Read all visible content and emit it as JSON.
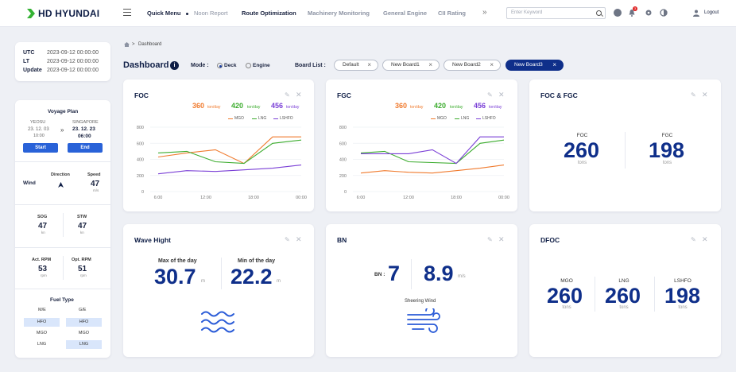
{
  "app": {
    "logo": "HD HYUNDAI",
    "nav": [
      "Quick Menu",
      "Noon Report",
      "Route Optimization",
      "Machinery Monitoring",
      "General Engine",
      "CII Rating"
    ],
    "search_placeholder": "Enter Keyword",
    "notification_count": "3",
    "logout": "Logout",
    "accent": "#2962d8",
    "brand_green": "#34b233"
  },
  "time": [
    {
      "label": "UTC",
      "value": "2023-09-12 00:00:00"
    },
    {
      "label": "LT",
      "value": "2023-09-12 00:00:00"
    },
    {
      "label": "Update",
      "value": "2023-09-12 00:00:00"
    }
  ],
  "voyage": {
    "title": "Voyage Plan",
    "from_port": "YEOSU",
    "to_port": "SINGAPORE",
    "from_date": "23. 12. 03",
    "from_time": "10:00",
    "to_date": "23. 12. 23",
    "to_time": "06:00",
    "start_label": "Start",
    "end_label": "End"
  },
  "wind": {
    "label": "Wind",
    "direction_label": "Direction",
    "speed_label": "Speed",
    "speed_value": "47",
    "speed_unit": "m/s"
  },
  "sog_stw": {
    "sog_label": "SOG",
    "sog_value": "47",
    "sog_unit": "kn",
    "stw_label": "STW",
    "stw_value": "47",
    "stw_unit": "kn"
  },
  "rpm": {
    "act_label": "Act. RPM",
    "act_value": "53",
    "act_unit": "rpm",
    "opt_label": "Opt. RPM",
    "opt_value": "51",
    "opt_unit": "rpm"
  },
  "fuel": {
    "title": "Fuel Type",
    "col1": "M/E",
    "col2": "G/E",
    "rows": [
      [
        "HFO",
        "HFO"
      ],
      [
        "MGO",
        "MGO"
      ],
      [
        "LNG",
        "LNG"
      ]
    ]
  },
  "breadcrumb": "Dashboard",
  "dashboard": {
    "title": "Dashboard",
    "info": "i",
    "mode_label": "Mode :",
    "mode_deck": "Deck",
    "mode_engine": "Engine",
    "board_label": "Board List :",
    "boards": [
      "Default",
      "New Board1",
      "New Board2",
      "New Board3"
    ],
    "active_board": "New Board3"
  },
  "cards": {
    "foc": {
      "title": "FOC",
      "v1": "360",
      "v2": "420",
      "v3": "456",
      "unit": "ton/day",
      "s1": "MGO",
      "s2": "LNG",
      "s3": "LSHFO"
    },
    "fgc": {
      "title": "FGC",
      "v1": "360",
      "v2": "420",
      "v3": "456",
      "unit": "ton/day",
      "s1": "MGO",
      "s2": "LNG",
      "s3": "LSHFO"
    },
    "foc_fgc": {
      "title": "FOC & FGC",
      "foc_label": "FOC",
      "foc_value": "260",
      "fgc_label": "FGC",
      "fgc_value": "198",
      "unit": "tons"
    },
    "wave": {
      "title": "Wave Hight",
      "max_label": "Max of the day",
      "max_value": "30.7",
      "min_label": "Min of the day",
      "min_value": "22.2",
      "unit": "m"
    },
    "bn": {
      "title": "BN",
      "bn_label": "BN :",
      "bn_value": "7",
      "speed_value": "8.9",
      "speed_unit": "m/s",
      "caption": "Sheering Wind"
    },
    "dfoc": {
      "title": "DFOC",
      "l1": "MGO",
      "v1": "260",
      "l2": "LNG",
      "v2": "260",
      "l3": "LSHFO",
      "v3": "198",
      "unit": "tons"
    }
  },
  "chart_data": [
    {
      "type": "line",
      "title": "FOC",
      "x": [
        "6:00",
        "12:00",
        "18:00",
        "00:00"
      ],
      "ylim": [
        0,
        800
      ],
      "yticks": [
        "800",
        "600",
        "400",
        "200",
        "0"
      ],
      "series": [
        {
          "name": "MGO",
          "color": "#f07a2d",
          "values": [
            430,
            480,
            520,
            350,
            680,
            680
          ]
        },
        {
          "name": "LNG",
          "color": "#3cac2e",
          "values": [
            480,
            500,
            370,
            350,
            600,
            640
          ]
        },
        {
          "name": "LSHFO",
          "color": "#7a3fd6",
          "values": [
            220,
            260,
            250,
            270,
            290,
            330
          ]
        }
      ]
    },
    {
      "type": "line",
      "title": "FGC",
      "x": [
        "6:00",
        "12:00",
        "18:00",
        "00:00"
      ],
      "ylim": [
        0,
        800
      ],
      "yticks": [
        "800",
        "600",
        "400",
        "200",
        "0"
      ],
      "series": [
        {
          "name": "MGO",
          "color": "#f07a2d",
          "values": [
            230,
            260,
            240,
            230,
            260,
            290,
            330
          ]
        },
        {
          "name": "LNG",
          "color": "#3cac2e",
          "values": [
            480,
            500,
            370,
            360,
            350,
            600,
            640
          ]
        },
        {
          "name": "LSHFO",
          "color": "#7a3fd6",
          "values": [
            470,
            470,
            470,
            520,
            350,
            680,
            680
          ]
        }
      ]
    }
  ]
}
